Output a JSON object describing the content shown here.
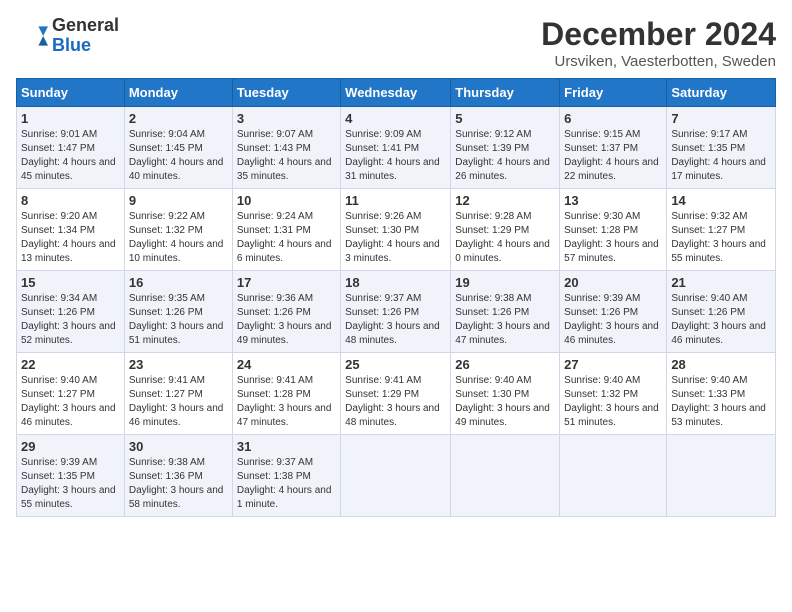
{
  "logo": {
    "general": "General",
    "blue": "Blue"
  },
  "header": {
    "title": "December 2024",
    "subtitle": "Ursviken, Vaesterbotten, Sweden"
  },
  "days_of_week": [
    "Sunday",
    "Monday",
    "Tuesday",
    "Wednesday",
    "Thursday",
    "Friday",
    "Saturday"
  ],
  "weeks": [
    [
      {
        "day": "1",
        "sunrise": "Sunrise: 9:01 AM",
        "sunset": "Sunset: 1:47 PM",
        "daylight": "Daylight: 4 hours and 45 minutes."
      },
      {
        "day": "2",
        "sunrise": "Sunrise: 9:04 AM",
        "sunset": "Sunset: 1:45 PM",
        "daylight": "Daylight: 4 hours and 40 minutes."
      },
      {
        "day": "3",
        "sunrise": "Sunrise: 9:07 AM",
        "sunset": "Sunset: 1:43 PM",
        "daylight": "Daylight: 4 hours and 35 minutes."
      },
      {
        "day": "4",
        "sunrise": "Sunrise: 9:09 AM",
        "sunset": "Sunset: 1:41 PM",
        "daylight": "Daylight: 4 hours and 31 minutes."
      },
      {
        "day": "5",
        "sunrise": "Sunrise: 9:12 AM",
        "sunset": "Sunset: 1:39 PM",
        "daylight": "Daylight: 4 hours and 26 minutes."
      },
      {
        "day": "6",
        "sunrise": "Sunrise: 9:15 AM",
        "sunset": "Sunset: 1:37 PM",
        "daylight": "Daylight: 4 hours and 22 minutes."
      },
      {
        "day": "7",
        "sunrise": "Sunrise: 9:17 AM",
        "sunset": "Sunset: 1:35 PM",
        "daylight": "Daylight: 4 hours and 17 minutes."
      }
    ],
    [
      {
        "day": "8",
        "sunrise": "Sunrise: 9:20 AM",
        "sunset": "Sunset: 1:34 PM",
        "daylight": "Daylight: 4 hours and 13 minutes."
      },
      {
        "day": "9",
        "sunrise": "Sunrise: 9:22 AM",
        "sunset": "Sunset: 1:32 PM",
        "daylight": "Daylight: 4 hours and 10 minutes."
      },
      {
        "day": "10",
        "sunrise": "Sunrise: 9:24 AM",
        "sunset": "Sunset: 1:31 PM",
        "daylight": "Daylight: 4 hours and 6 minutes."
      },
      {
        "day": "11",
        "sunrise": "Sunrise: 9:26 AM",
        "sunset": "Sunset: 1:30 PM",
        "daylight": "Daylight: 4 hours and 3 minutes."
      },
      {
        "day": "12",
        "sunrise": "Sunrise: 9:28 AM",
        "sunset": "Sunset: 1:29 PM",
        "daylight": "Daylight: 4 hours and 0 minutes."
      },
      {
        "day": "13",
        "sunrise": "Sunrise: 9:30 AM",
        "sunset": "Sunset: 1:28 PM",
        "daylight": "Daylight: 3 hours and 57 minutes."
      },
      {
        "day": "14",
        "sunrise": "Sunrise: 9:32 AM",
        "sunset": "Sunset: 1:27 PM",
        "daylight": "Daylight: 3 hours and 55 minutes."
      }
    ],
    [
      {
        "day": "15",
        "sunrise": "Sunrise: 9:34 AM",
        "sunset": "Sunset: 1:26 PM",
        "daylight": "Daylight: 3 hours and 52 minutes."
      },
      {
        "day": "16",
        "sunrise": "Sunrise: 9:35 AM",
        "sunset": "Sunset: 1:26 PM",
        "daylight": "Daylight: 3 hours and 51 minutes."
      },
      {
        "day": "17",
        "sunrise": "Sunrise: 9:36 AM",
        "sunset": "Sunset: 1:26 PM",
        "daylight": "Daylight: 3 hours and 49 minutes."
      },
      {
        "day": "18",
        "sunrise": "Sunrise: 9:37 AM",
        "sunset": "Sunset: 1:26 PM",
        "daylight": "Daylight: 3 hours and 48 minutes."
      },
      {
        "day": "19",
        "sunrise": "Sunrise: 9:38 AM",
        "sunset": "Sunset: 1:26 PM",
        "daylight": "Daylight: 3 hours and 47 minutes."
      },
      {
        "day": "20",
        "sunrise": "Sunrise: 9:39 AM",
        "sunset": "Sunset: 1:26 PM",
        "daylight": "Daylight: 3 hours and 46 minutes."
      },
      {
        "day": "21",
        "sunrise": "Sunrise: 9:40 AM",
        "sunset": "Sunset: 1:26 PM",
        "daylight": "Daylight: 3 hours and 46 minutes."
      }
    ],
    [
      {
        "day": "22",
        "sunrise": "Sunrise: 9:40 AM",
        "sunset": "Sunset: 1:27 PM",
        "daylight": "Daylight: 3 hours and 46 minutes."
      },
      {
        "day": "23",
        "sunrise": "Sunrise: 9:41 AM",
        "sunset": "Sunset: 1:27 PM",
        "daylight": "Daylight: 3 hours and 46 minutes."
      },
      {
        "day": "24",
        "sunrise": "Sunrise: 9:41 AM",
        "sunset": "Sunset: 1:28 PM",
        "daylight": "Daylight: 3 hours and 47 minutes."
      },
      {
        "day": "25",
        "sunrise": "Sunrise: 9:41 AM",
        "sunset": "Sunset: 1:29 PM",
        "daylight": "Daylight: 3 hours and 48 minutes."
      },
      {
        "day": "26",
        "sunrise": "Sunrise: 9:40 AM",
        "sunset": "Sunset: 1:30 PM",
        "daylight": "Daylight: 3 hours and 49 minutes."
      },
      {
        "day": "27",
        "sunrise": "Sunrise: 9:40 AM",
        "sunset": "Sunset: 1:32 PM",
        "daylight": "Daylight: 3 hours and 51 minutes."
      },
      {
        "day": "28",
        "sunrise": "Sunrise: 9:40 AM",
        "sunset": "Sunset: 1:33 PM",
        "daylight": "Daylight: 3 hours and 53 minutes."
      }
    ],
    [
      {
        "day": "29",
        "sunrise": "Sunrise: 9:39 AM",
        "sunset": "Sunset: 1:35 PM",
        "daylight": "Daylight: 3 hours and 55 minutes."
      },
      {
        "day": "30",
        "sunrise": "Sunrise: 9:38 AM",
        "sunset": "Sunset: 1:36 PM",
        "daylight": "Daylight: 3 hours and 58 minutes."
      },
      {
        "day": "31",
        "sunrise": "Sunrise: 9:37 AM",
        "sunset": "Sunset: 1:38 PM",
        "daylight": "Daylight: 4 hours and 1 minute."
      },
      null,
      null,
      null,
      null
    ]
  ]
}
